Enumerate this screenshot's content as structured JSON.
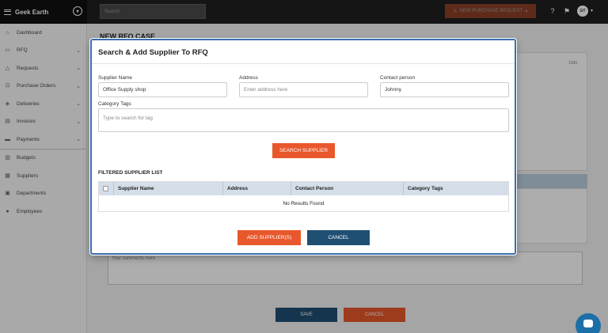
{
  "app": {
    "name": "Geek Earth"
  },
  "topbar": {
    "search_placeholder": "Search",
    "new_purchase_request_label": "NEW PURCHASE REQUEST",
    "avatar_initials": "GT"
  },
  "sidebar": {
    "items": [
      {
        "label": "Dashboard",
        "icon": "home-icon",
        "has_chevron": false
      },
      {
        "label": "RFQ",
        "icon": "document-icon",
        "has_chevron": true
      },
      {
        "label": "Requests",
        "icon": "bell-icon",
        "has_chevron": true
      },
      {
        "label": "Purchase Orders",
        "icon": "cart-icon",
        "has_chevron": true
      },
      {
        "label": "Deliveries",
        "icon": "box-icon",
        "has_chevron": true
      },
      {
        "label": "Invoices",
        "icon": "invoice-icon",
        "has_chevron": true
      },
      {
        "label": "Payments",
        "icon": "payment-icon",
        "has_chevron": true
      },
      {
        "label": "Budgets",
        "icon": "budget-icon",
        "has_chevron": false
      },
      {
        "label": "Suppliers",
        "icon": "supplier-icon",
        "has_chevron": false
      },
      {
        "label": "Departments",
        "icon": "department-icon",
        "has_chevron": false
      },
      {
        "label": "Employees",
        "icon": "employees-icon",
        "has_chevron": false
      }
    ]
  },
  "page": {
    "title": "NEW RFQ CASE",
    "comment_placeholder": "Your comments here",
    "save_label": "SAVE",
    "cancel_label": "CANCEL",
    "small_label": "1000"
  },
  "modal": {
    "title": "Search & Add Supplier To RFQ",
    "supplier_name": {
      "label": "Supplier Name",
      "value": "Office Supply shop"
    },
    "address": {
      "label": "Address",
      "placeholder": "Enter address here"
    },
    "contact_person": {
      "label": "Contact person",
      "value": "Johnny"
    },
    "category_tags": {
      "label": "Category Tags",
      "placeholder": "Type to search for tag"
    },
    "search_button": "SEARCH SUPPLIER",
    "list_title": "FILTERED SUPPLIER LIST",
    "table": {
      "columns": [
        "Supplier Name",
        "Address",
        "Contact Person",
        "Category Tags"
      ],
      "empty_message": "No Results Found"
    },
    "add_button": "ADD SUPPLIER(S)",
    "cancel_button": "CANCEL"
  },
  "colors": {
    "accent_orange": "#e8582c",
    "primary_blue": "#1f4f73",
    "header_dark": "#1f1f1f",
    "table_header": "#d4dee8",
    "modal_border": "#3b6db0"
  }
}
